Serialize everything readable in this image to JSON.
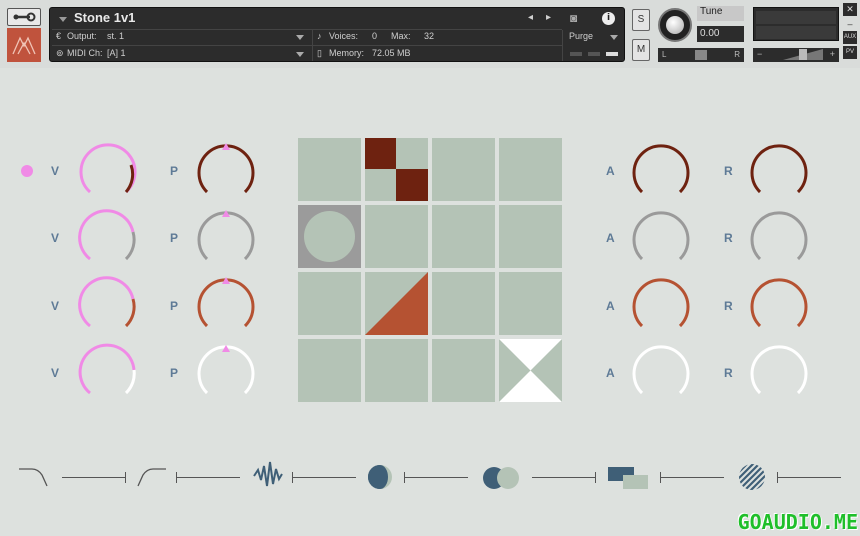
{
  "header": {
    "instrument_name": "Stone 1v1",
    "output_label": "Output:",
    "output_value": "st. 1",
    "midi_label": "MIDI Ch:",
    "midi_value": "[A]  1",
    "voices_label": "Voices:",
    "voices_value": "0",
    "max_label": "Max:",
    "max_value": "32",
    "memory_label": "Memory:",
    "memory_value": "72.05 MB",
    "purge_label": "Purge",
    "solo_label": "S",
    "mute_label": "M",
    "tune_label": "Tune",
    "tune_value": "0.00",
    "pan_left": "L",
    "pan_right": "R",
    "aux_label": "AUX",
    "pv_label": "PV",
    "close_label": "✕"
  },
  "rows": [
    {
      "v": "V",
      "p": "P",
      "a": "A",
      "r": "R"
    },
    {
      "v": "V",
      "p": "P",
      "a": "A",
      "r": "R"
    },
    {
      "v": "V",
      "p": "P",
      "a": "A",
      "r": "R"
    },
    {
      "v": "V",
      "p": "P",
      "a": "A",
      "r": "R"
    }
  ],
  "colors": {
    "pink": "#f08ae6",
    "dark_red": "#6e2210",
    "grey": "#9a9a9a",
    "rust": "#b55232",
    "white": "#ffffff",
    "cell": "#b4c3b6"
  },
  "watermark": "GOAUDIO.ME"
}
